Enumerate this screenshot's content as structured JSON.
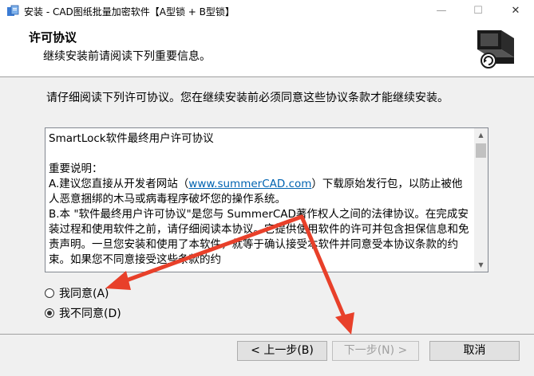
{
  "window": {
    "title": "安装 - CAD图纸批量加密软件【A型锁 + B型锁】",
    "minimize": "—",
    "maximize": "☐",
    "close": "✕"
  },
  "header": {
    "title": "许可协议",
    "subtitle": "继续安装前请阅读下列重要信息。"
  },
  "body": {
    "instruction": "请仔细阅读下列许可协议。您在继续安装前必须同意这些协议条款才能继续安装。",
    "license": {
      "line1": "SmartLock软件最终用户许可协议",
      "line2": "重要说明：",
      "line3a": "A.建议您直接从开发者网站（",
      "link": "www.summerCAD.com",
      "line3b": "）下载原始发行包，以防止被他人恶意捆绑的木马或病毒程序破坏您的操作系统。",
      "line4": "B.本 \"软件最终用户许可协议\"是您与 SummerCAD著作权人之间的法律协议。在完成安装过程和使用软件之前，请仔细阅读本协议。它提供使用软件的许可并包含担保信息和免责声明。一旦您安装和使用了本软件，就等于确认接受本软件并同意受本协议条款的约束。如果您不同意接受这些条款的约"
    },
    "radio_accept": "我同意(A)",
    "radio_decline": "我不同意(D)",
    "selected": "decline"
  },
  "footer": {
    "back": "< 上一步(B)",
    "next": "下一步(N) >",
    "cancel": "取消"
  },
  "colors": {
    "annotation_arrow": "#e8402a"
  }
}
